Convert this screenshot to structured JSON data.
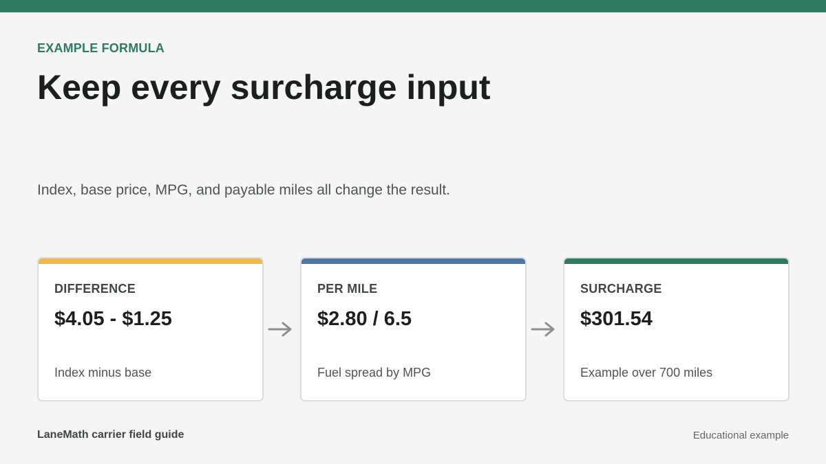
{
  "colors": {
    "brand": "#2e7b62",
    "difference_accent": "#efb94b",
    "per_mile_accent": "#4f77a3",
    "surcharge_accent": "#2e7b62",
    "arrow": "#8a918d"
  },
  "header": {
    "eyebrow": "EXAMPLE FORMULA",
    "title": "Keep every surcharge input",
    "subtitle": "Index, base price, MPG, and payable miles all change the result."
  },
  "cards": [
    {
      "label": "DIFFERENCE",
      "value": "$4.05 - $1.25",
      "note": "Index minus base"
    },
    {
      "label": "PER MILE",
      "value": "$2.80 / 6.5",
      "note": "Fuel spread by MPG"
    },
    {
      "label": "SURCHARGE",
      "value": "$301.54",
      "note": "Example over 700 miles"
    }
  ],
  "arrows": [
    "arrow-right-icon",
    "arrow-right-icon"
  ],
  "footer": {
    "brand": "LaneMath carrier field guide",
    "note": "Educational example"
  }
}
